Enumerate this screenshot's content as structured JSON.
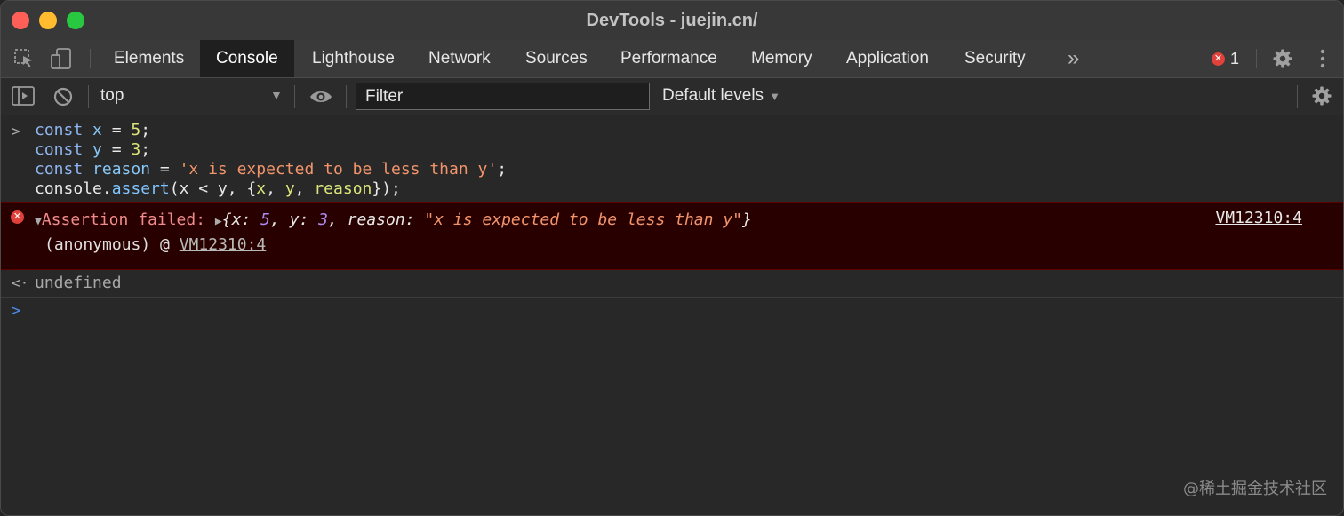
{
  "window": {
    "title": "DevTools - juejin.cn/"
  },
  "tabs": [
    {
      "label": "Elements"
    },
    {
      "label": "Console"
    },
    {
      "label": "Lighthouse"
    },
    {
      "label": "Network"
    },
    {
      "label": "Sources"
    },
    {
      "label": "Performance"
    },
    {
      "label": "Memory"
    },
    {
      "label": "Application"
    },
    {
      "label": "Security"
    }
  ],
  "active_tab": "Console",
  "overflow_label": "»",
  "error_badge": {
    "icon": "✕",
    "count": "1"
  },
  "toolbar": {
    "context": "top",
    "filter_placeholder": "Filter",
    "levels": "Default levels"
  },
  "console": {
    "input": {
      "l1": {
        "kw": "const",
        "name": "x",
        "op": " = ",
        "num": "5",
        "end": ";"
      },
      "l2": {
        "kw": "const",
        "name": "y",
        "op": " = ",
        "num": "3",
        "end": ";"
      },
      "l3": {
        "kw": "const",
        "name": "reason",
        "op": " = ",
        "str": "'x is expected to be less than y'",
        "end": ";"
      },
      "l4": {
        "obj": "console",
        "dot": ".",
        "fn": "assert",
        "args_pre": "(x < y, {",
        "a1": "x",
        "sep1": ", ",
        "a2": "y",
        "sep2": ", ",
        "a3": "reason",
        "args_post": "});"
      }
    },
    "error": {
      "label": "Assertion failed: ",
      "obj_open": "{",
      "k1": "x: ",
      "v1": "5",
      "s1": ", ",
      "k2": "y: ",
      "v2": "3",
      "s2": ", ",
      "k3": "reason: ",
      "v3": "\"x is expected to be less than y\"",
      "obj_close": "}",
      "source": "VM12310:4",
      "stack_fn": "(anonymous) @ ",
      "stack_link": "VM12310:4"
    },
    "result": "undefined"
  },
  "watermark": "@稀土掘金技术社区",
  "colors": {
    "error_bg": "#290000",
    "error_text": "#f08b8b",
    "active_tab_bg": "#1f1f1f"
  }
}
